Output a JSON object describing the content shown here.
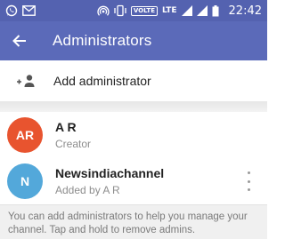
{
  "status_bar": {
    "icons": [
      "whatsapp-icon",
      "gmail-icon",
      "hotspot-icon",
      "vibrate-icon",
      "volte-badge",
      "lte-indicator",
      "signal-icon",
      "signal-icon",
      "battery-icon"
    ],
    "volte_text": "VOLTE",
    "lte_text": "LTE",
    "time": "22:42",
    "color": "#5462b0"
  },
  "app_bar": {
    "title": "Administrators",
    "back_icon": "arrow-back-icon",
    "color": "#5b6ab9"
  },
  "add_admin": {
    "label": "Add administrator",
    "icon": "add-admin-icon"
  },
  "admins": [
    {
      "initials": "AR",
      "name": "A R",
      "subtitle": "Creator",
      "avatar_color": "#e8542f",
      "has_menu": false
    },
    {
      "initials": "N",
      "name": "Newsindiachannel",
      "subtitle": "Added by A R",
      "avatar_color": "#53a8da",
      "has_menu": true
    }
  ],
  "info_text": "You can add administrators to help you manage your channel. Tap and hold to remove admins."
}
